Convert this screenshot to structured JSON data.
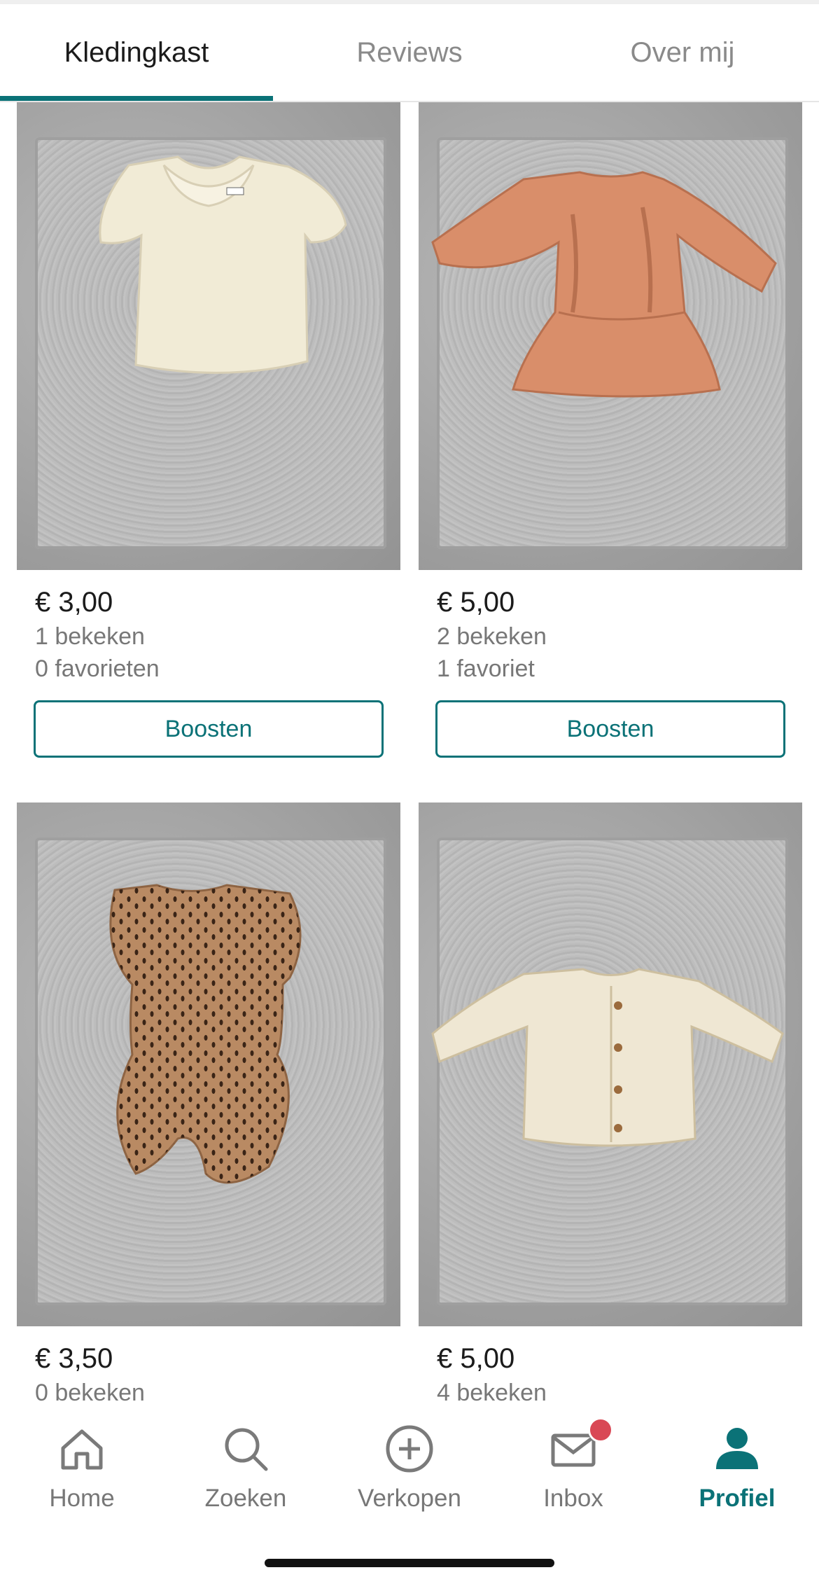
{
  "tabs": [
    {
      "label": "Kledingkast",
      "active": true
    },
    {
      "label": "Reviews",
      "active": false
    },
    {
      "label": "Over mij",
      "active": false
    }
  ],
  "items": [
    {
      "price": "€ 3,00",
      "views": "1 bekeken",
      "favorites": "0 favorieten",
      "boost_label": "Boosten",
      "image": "cream-ruffle-top"
    },
    {
      "price": "€ 5,00",
      "views": "2 bekeken",
      "favorites": "1 favoriet",
      "boost_label": "Boosten",
      "image": "orange-ruffle-dress"
    },
    {
      "price": "€ 3,50",
      "views": "0 bekeken",
      "image": "brown-dotted-romper"
    },
    {
      "price": "€ 5,00",
      "views": "4 bekeken",
      "image": "cream-eyelet-cardigan"
    }
  ],
  "nav": [
    {
      "label": "Home",
      "icon": "home-icon",
      "active": false
    },
    {
      "label": "Zoeken",
      "icon": "search-icon",
      "active": false
    },
    {
      "label": "Verkopen",
      "icon": "plus-circle-icon",
      "active": false
    },
    {
      "label": "Inbox",
      "icon": "mail-icon",
      "active": false,
      "notification_dot": true
    },
    {
      "label": "Profiel",
      "icon": "profile-icon",
      "active": true
    }
  ],
  "colors": {
    "accent": "#0b7277",
    "badge": "#d94855",
    "muted_text": "#777777"
  }
}
